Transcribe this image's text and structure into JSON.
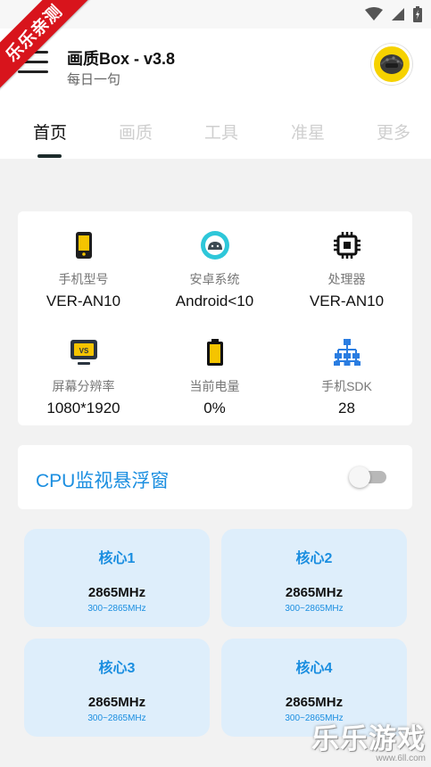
{
  "header": {
    "title": "画质Box - v3.8",
    "subtitle": "每日一句"
  },
  "tabs": [
    {
      "label": "首页",
      "active": true
    },
    {
      "label": "画质",
      "active": false
    },
    {
      "label": "工具",
      "active": false
    },
    {
      "label": "准星",
      "active": false
    },
    {
      "label": "更多",
      "active": false
    }
  ],
  "device_info": [
    {
      "icon": "phone-icon",
      "label": "手机型号",
      "value": "VER-AN10"
    },
    {
      "icon": "android-icon",
      "label": "安卓系统",
      "value": "Android<10"
    },
    {
      "icon": "processor-icon",
      "label": "处理器",
      "value": "VER-AN10"
    },
    {
      "icon": "monitor-icon",
      "label": "屏幕分辨率",
      "value": "1080*1920"
    },
    {
      "icon": "battery-icon",
      "label": "当前电量",
      "value": "0%"
    },
    {
      "icon": "sdk-hierarchy-icon",
      "label": "手机SDK",
      "value": "28"
    }
  ],
  "cpu_monitor": {
    "label": "CPU监视悬浮窗",
    "enabled": false
  },
  "cores": [
    {
      "name": "核心1",
      "freq": "2865MHz",
      "range": "300~2865MHz"
    },
    {
      "name": "核心2",
      "freq": "2865MHz",
      "range": "300~2865MHz"
    },
    {
      "name": "核心3",
      "freq": "2865MHz",
      "range": "300~2865MHz"
    },
    {
      "name": "核心4",
      "freq": "2865MHz",
      "range": "300~2865MHz"
    }
  ],
  "overlay": {
    "ribbon_text": "乐乐亲测",
    "watermark_text": "乐乐游戏",
    "watermark_url": "www.6ll.com"
  },
  "colors": {
    "accent": "#1a8ee0",
    "card_tint": "#deeefb",
    "ribbon": "#d8141c",
    "avatar_bg": "#f6d200"
  }
}
